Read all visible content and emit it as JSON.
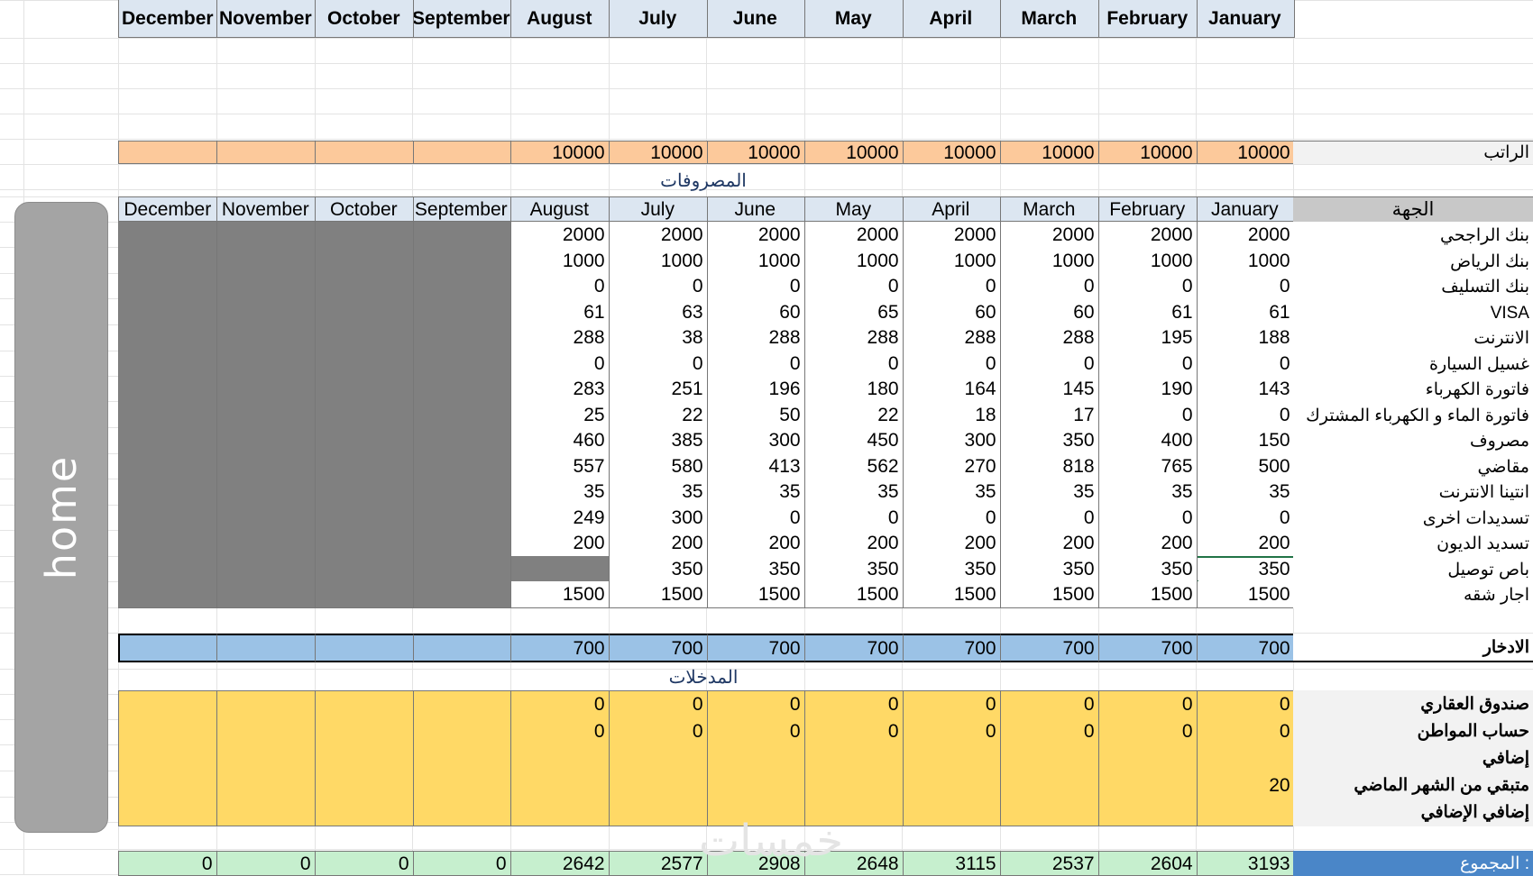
{
  "months_header": [
    "January",
    "February",
    "March",
    "April",
    "May",
    "June",
    "July",
    "August",
    "September",
    "October",
    "November",
    "December"
  ],
  "salary": {
    "label": "الراتب",
    "values": [
      "10000",
      "10000",
      "10000",
      "10000",
      "10000",
      "10000",
      "10000",
      "10000",
      "",
      "",
      "",
      ""
    ]
  },
  "expenses_title": "المصروفات",
  "expenses_header_label": "الجهة",
  "expenses": [
    {
      "label": "بنك الراجحي",
      "values": [
        "2000",
        "2000",
        "2000",
        "2000",
        "2000",
        "2000",
        "2000",
        "2000"
      ]
    },
    {
      "label": "بنك الرياض",
      "values": [
        "1000",
        "1000",
        "1000",
        "1000",
        "1000",
        "1000",
        "1000",
        "1000"
      ]
    },
    {
      "label": "بنك التسليف",
      "values": [
        "0",
        "0",
        "0",
        "0",
        "0",
        "0",
        "0",
        "0"
      ]
    },
    {
      "label": "VISA",
      "values": [
        "61",
        "61",
        "60",
        "60",
        "65",
        "60",
        "63",
        "61"
      ]
    },
    {
      "label": "الانترنت",
      "values": [
        "188",
        "195",
        "288",
        "288",
        "288",
        "288",
        "38",
        "288"
      ]
    },
    {
      "label": "غسيل السيارة",
      "values": [
        "0",
        "0",
        "0",
        "0",
        "0",
        "0",
        "0",
        "0"
      ]
    },
    {
      "label": "فاتورة الكهرباء",
      "values": [
        "143",
        "190",
        "145",
        "164",
        "180",
        "196",
        "251",
        "283"
      ]
    },
    {
      "label": "فاتورة الماء و الكهرباء المشترك",
      "values": [
        "0",
        "0",
        "17",
        "18",
        "22",
        "50",
        "22",
        "25"
      ]
    },
    {
      "label": "مصروف",
      "values": [
        "150",
        "400",
        "350",
        "300",
        "450",
        "300",
        "385",
        "460"
      ]
    },
    {
      "label": "مقاضي",
      "values": [
        "500",
        "765",
        "818",
        "270",
        "562",
        "413",
        "580",
        "557"
      ]
    },
    {
      "label": "انتينا الانترنت",
      "values": [
        "35",
        "35",
        "35",
        "35",
        "35",
        "35",
        "35",
        "35"
      ]
    },
    {
      "label": "تسديدات اخرى",
      "values": [
        "0",
        "0",
        "0",
        "0",
        "0",
        "0",
        "300",
        "249"
      ]
    },
    {
      "label": "تسديد الديون",
      "values": [
        "200",
        "200",
        "200",
        "200",
        "200",
        "200",
        "200",
        "200"
      ]
    },
    {
      "label": "باص توصيل",
      "values": [
        "350",
        "350",
        "350",
        "350",
        "350",
        "350",
        "350",
        ""
      ]
    },
    {
      "label": "اجار شقه",
      "values": [
        "1500",
        "1500",
        "1500",
        "1500",
        "1500",
        "1500",
        "1500",
        "1500"
      ]
    }
  ],
  "savings": {
    "label": "الادخار",
    "values": [
      "700",
      "700",
      "700",
      "700",
      "700",
      "700",
      "700",
      "700",
      "",
      "",
      "",
      ""
    ]
  },
  "income_title": "المدخلات",
  "income": [
    {
      "label": "صندوق العقاري",
      "values": [
        "0",
        "0",
        "0",
        "0",
        "0",
        "0",
        "0",
        "0",
        "",
        "",
        "",
        ""
      ]
    },
    {
      "label": "حساب المواطن",
      "values": [
        "0",
        "0",
        "0",
        "0",
        "0",
        "0",
        "0",
        "0",
        "",
        "",
        "",
        ""
      ]
    },
    {
      "label": "إضافي",
      "values": [
        "",
        "",
        "",
        "",
        "",
        "",
        "",
        "",
        "",
        "",
        "",
        ""
      ]
    },
    {
      "label": "متبقي من الشهر الماضي",
      "values": [
        "20",
        "",
        "",
        "",
        "",
        "",
        "",
        "",
        "",
        "",
        "",
        ""
      ]
    },
    {
      "label": "إضافي الإضافي",
      "values": [
        "",
        "",
        "",
        "",
        "",
        "",
        "",
        "",
        "",
        "",
        "",
        ""
      ]
    }
  ],
  "total": {
    "label": "المجموع :",
    "values": [
      "3193",
      "2604",
      "2537",
      "3115",
      "2648",
      "2908",
      "2577",
      "2642",
      "0",
      "0",
      "0",
      "0"
    ]
  },
  "home_button": "home",
  "watermark": "خمسات",
  "colors": {
    "header": "#dce6f1",
    "salary": "#fcc99b",
    "dark": "#808080",
    "savings": "#9bc2e6",
    "income": "#ffd966",
    "total": "#c6efce",
    "total_label": "#4a86c8",
    "label_bg": "#f2f2f2",
    "label_header": "#c8c8c8"
  }
}
